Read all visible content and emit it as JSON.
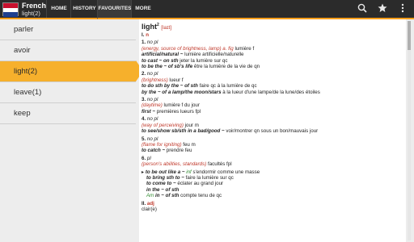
{
  "app": {
    "title": "French",
    "subtitle": "light(2)",
    "logo_text": "FRENCH"
  },
  "tabs": [
    {
      "label": "HOME"
    },
    {
      "label": "HISTORY"
    },
    {
      "label": "FAVOURITES"
    },
    {
      "label": "MORE"
    }
  ],
  "toolbar": {
    "search_icon": "search-icon",
    "star_icon": "star-icon",
    "menu_icon": "overflow-menu-icon"
  },
  "list": {
    "items": [
      {
        "label": "parler"
      },
      {
        "label": "avoir"
      },
      {
        "label": "light(2)"
      },
      {
        "label": "leave(1)"
      },
      {
        "label": "keep"
      }
    ],
    "selected_index": 2
  },
  "entry": {
    "headword": "light",
    "hom": "2",
    "phon": "[laɪt]",
    "part1": {
      "roman": "I.",
      "pos": "n"
    },
    "senses": {
      "s1": {
        "num": "1.",
        "gram": "no pl",
        "label": "(energy, source of brightness, lamp) a. fig",
        "tr": "lumière f",
        "ex1": "artificial/natural ~",
        "ex1_tr": "lumière artificielle/naturelle",
        "ex2": "to cast ~ on sth",
        "ex2_tr": "jeter la lumière sur qc",
        "ex3": "to be the ~ of sb's life",
        "ex3_tr": "être la lumière de la vie de qn"
      },
      "s2": {
        "num": "2.",
        "gram": "no pl",
        "label": "(brightness)",
        "tr": "lueur f",
        "ex1": "to do sth by the ~ of sth",
        "ex1_tr": "faire qc à la lumière de qc",
        "ex2": "by the ~ of a lamp/the moon/stars",
        "ex2_tr": "à la lueur d'une lampe/de la lune/des étoiles"
      },
      "s3": {
        "num": "3.",
        "gram": "no pl",
        "label": "(daytime)",
        "tr": "lumière f du jour",
        "ex1": "first ~",
        "ex1_tr": "premières lueurs fpl"
      },
      "s4": {
        "num": "4.",
        "gram": "no pl",
        "label": "(way of perceiving)",
        "tr": "jour m",
        "ex1": "to see/show sb/sth in a bad/good ~",
        "ex1_tr": "voir/montrer qn sous un bon/mauvais jour"
      },
      "s5": {
        "num": "5.",
        "gram": "no pl",
        "label": "(flame for igniting)",
        "tr": "feu m",
        "ex1": "to catch ~",
        "ex1_tr": "prendre feu"
      },
      "s6": {
        "num": "6.",
        "gram": "pl",
        "label": "(person's abilities, standards)",
        "tr": "facultés fpl",
        "ex1": "to be out like a ~",
        "ex1_label": "inf",
        "ex1_tr": "s'endormir comme une masse",
        "ex2": "to bring sth to ~",
        "ex2_tr": "faire la lumière sur qc",
        "ex3": "to come to ~",
        "ex3_tr": "éclater au grand jour",
        "ex4": "in the ~ of sth",
        "ex4_tr": "",
        "ex5": "in ~ of sth",
        "ex5_label": "Am",
        "ex5_tr": "compte tenu de qc"
      }
    },
    "part2": {
      "roman": "II.",
      "pos": "adj",
      "tr": "clair(e)"
    }
  },
  "colors": {
    "accent": "#f6b02c",
    "topbar": "#2b2b2b",
    "label": "#c0392b",
    "green": "#2e8b2e"
  }
}
